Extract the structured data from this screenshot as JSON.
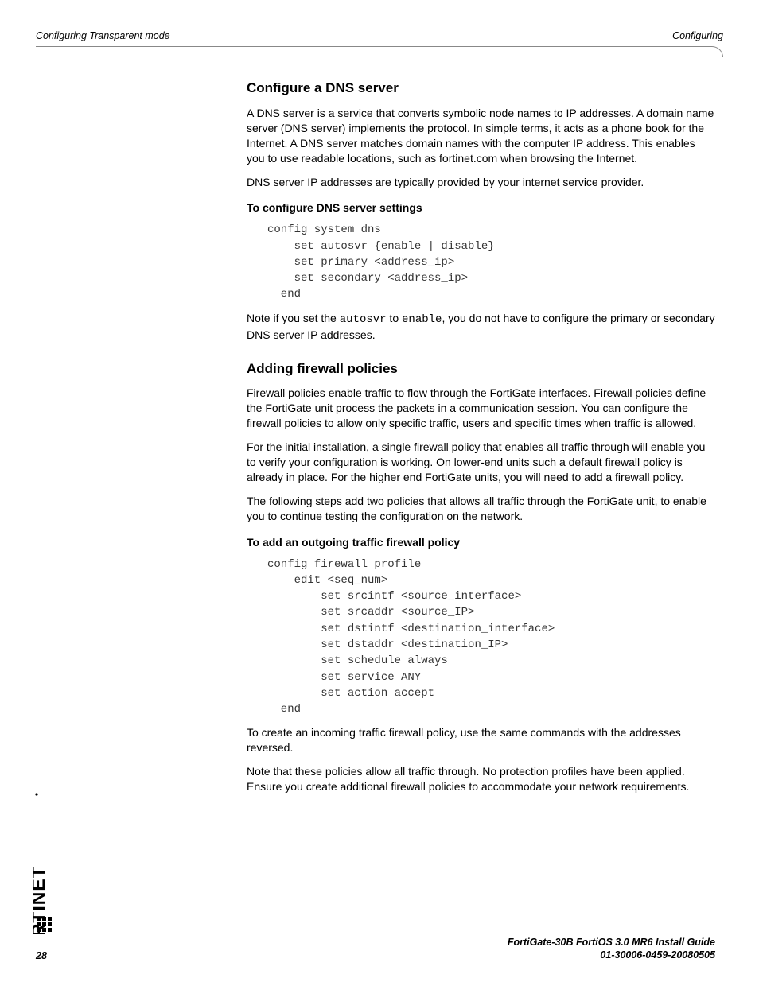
{
  "header": {
    "left": "Configuring Transparent mode",
    "right": "Configuring"
  },
  "sections": {
    "dns": {
      "title": "Configure a DNS server",
      "p1": "A DNS server is a service that converts symbolic node names to IP addresses. A domain name server (DNS server) implements the protocol. In simple terms, it acts as a phone book for the Internet. A DNS server matches domain names with the computer IP address. This enables you to use readable locations, such as fortinet.com when browsing the Internet.",
      "p2": "DNS server IP addresses are typically provided by your internet service provider.",
      "sub1": "To configure DNS server settings",
      "code1": "config system dns\n    set autosvr {enable | disable}\n    set primary <address_ip>\n    set secondary <address_ip>\n  end",
      "note_pre": "Note if you set the ",
      "note_code1": "autosvr",
      "note_mid": " to ",
      "note_code2": "enable",
      "note_post": ", you do not have to configure the primary or secondary DNS server IP addresses."
    },
    "fw": {
      "title": "Adding firewall policies",
      "p1": "Firewall policies enable traffic to flow through the FortiGate interfaces. Firewall policies define the FortiGate unit process the packets in a communication session. You can configure the firewall policies to allow only specific traffic, users and specific times when traffic is allowed.",
      "p2": "For the initial installation, a single firewall policy that enables all traffic through will enable you to verify your configuration is working. On lower-end units such a default firewall policy is already in place. For the higher end FortiGate units, you will need to add a firewall policy.",
      "p3": "The following steps add two policies that allows all traffic through the FortiGate unit, to enable you to continue testing the configuration on the network.",
      "sub1": "To add an outgoing traffic firewall policy",
      "code1": "config firewall profile\n    edit <seq_num>\n        set srcintf <source_interface>\n        set srcaddr <source_IP>\n        set dstintf <destination_interface>\n        set dstaddr <destination_IP>\n        set schedule always\n        set service ANY\n        set action accept\n  end",
      "p4": "To create an incoming traffic firewall policy, use the same commands with the addresses reversed.",
      "p5": "Note that these policies allow all traffic through. No protection profiles have been applied. Ensure you create additional firewall policies to accommodate your network requirements."
    }
  },
  "footer": {
    "page": "28",
    "line1": "FortiGate-30B FortiOS 3.0 MR6 Install Guide",
    "line2": "01-30006-0459-20080505"
  }
}
